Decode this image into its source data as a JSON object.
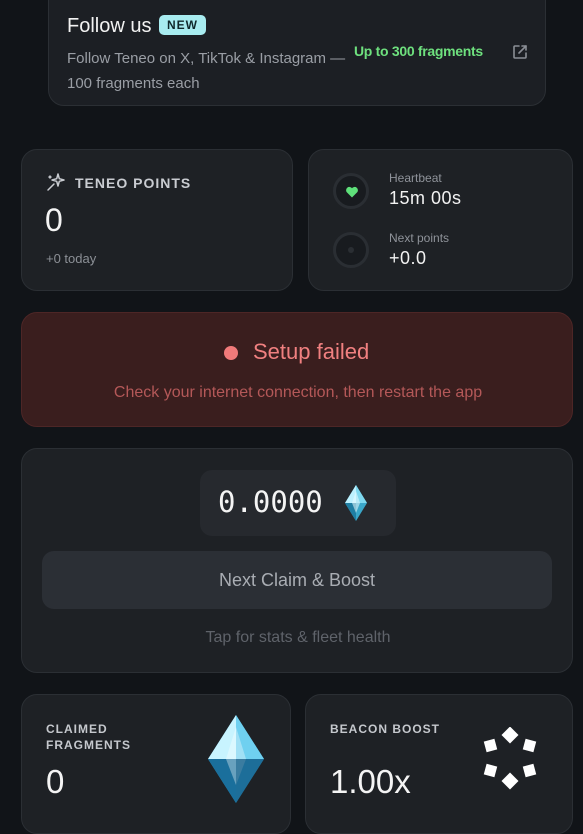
{
  "follow": {
    "title": "Follow us",
    "badge": "NEW",
    "description": "Follow Teneo on X, TikTok & Instagram — 100 fragments each",
    "reward": "Up to 300 fragments",
    "icon": "external-link-icon"
  },
  "points": {
    "label": "TENEO POINTS",
    "value": "0",
    "today": "+0 today",
    "icon": "sparkle-icon"
  },
  "heartbeat": {
    "label": "Heartbeat",
    "value": "15m 00s",
    "next_label": "Next points",
    "next_value": "+0.0",
    "icon": "heart-icon"
  },
  "setup": {
    "title": "Setup failed",
    "message": "Check your internet connection, then restart the app"
  },
  "claim": {
    "balance": "0.0000",
    "button_label": "Next Claim & Boost",
    "hint": "Tap for stats & fleet health"
  },
  "fragments": {
    "label": "CLAIMED FRAGMENTS",
    "value": "0",
    "icon": "crystal-icon"
  },
  "beacon": {
    "label": "BEACON BOOST",
    "value": "1.00x",
    "icon": "beacon-icon"
  },
  "colors": {
    "background": "#111418",
    "card": "#1e2125",
    "accent_green": "#6ee07e",
    "badge": "#a8ecf0",
    "error": "#f08080",
    "error_bg": "#3a1e1e"
  }
}
